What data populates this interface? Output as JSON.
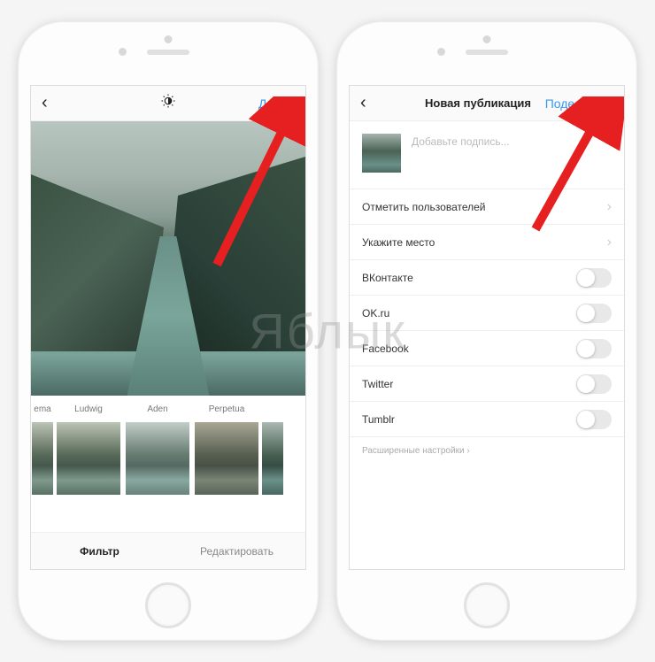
{
  "watermark": "Яблык",
  "screen1": {
    "header": {
      "next": "Далее"
    },
    "filters": [
      {
        "name": "ema"
      },
      {
        "name": "Ludwig"
      },
      {
        "name": "Aden"
      },
      {
        "name": "Perpetua"
      }
    ],
    "tabs": {
      "filter": "Фильтр",
      "edit": "Редактировать"
    }
  },
  "screen2": {
    "header": {
      "title": "Новая публикация",
      "share": "Поделиться"
    },
    "caption_placeholder": "Добавьте подпись...",
    "rows": {
      "tag_users": "Отметить пользователей",
      "add_location": "Укажите место"
    },
    "socials": [
      {
        "name": "ВКонтакте"
      },
      {
        "name": "OK.ru"
      },
      {
        "name": "Facebook"
      },
      {
        "name": "Twitter"
      },
      {
        "name": "Tumblr"
      }
    ],
    "advanced": "Расширенные настройки"
  }
}
